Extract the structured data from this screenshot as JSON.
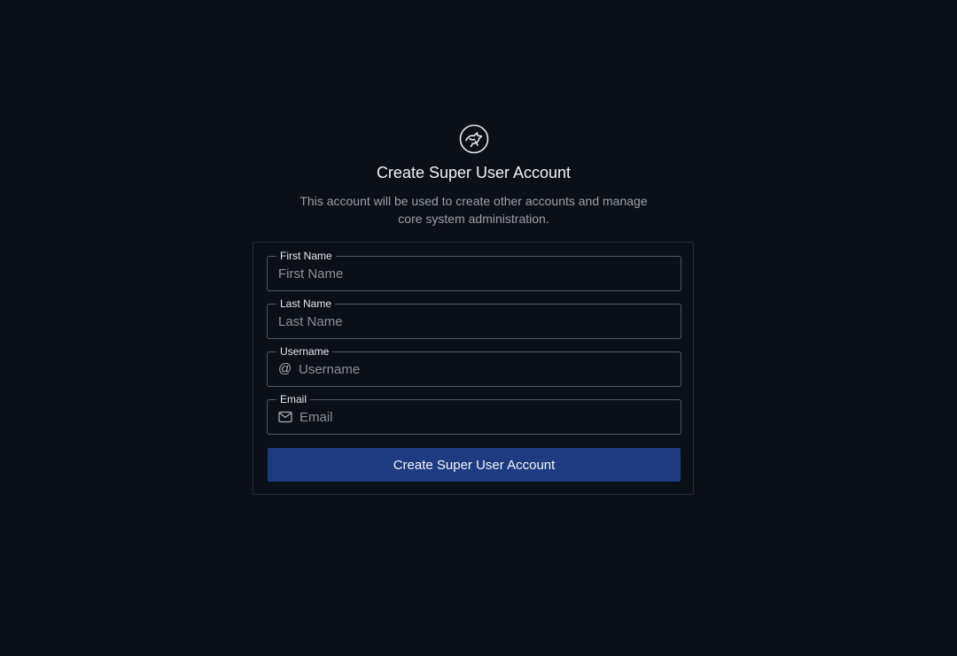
{
  "header": {
    "logo_icon": "app-logo-icon",
    "title": "Create Super User Account",
    "subtitle": "This account will be used to create other accounts and manage core system administration."
  },
  "form": {
    "fields": [
      {
        "label": "First Name",
        "placeholder": "First Name",
        "value": ""
      },
      {
        "label": "Last Name",
        "placeholder": "Last Name",
        "value": ""
      },
      {
        "label": "Username",
        "placeholder": "Username",
        "value": "",
        "prefix": "@"
      },
      {
        "label": "Email",
        "placeholder": "Email",
        "value": "",
        "icon": "mail-icon"
      }
    ],
    "submit_label": "Create Super User Account"
  },
  "colors": {
    "background": "#0a0f18",
    "button": "#1e3a80",
    "border": "#525862"
  }
}
